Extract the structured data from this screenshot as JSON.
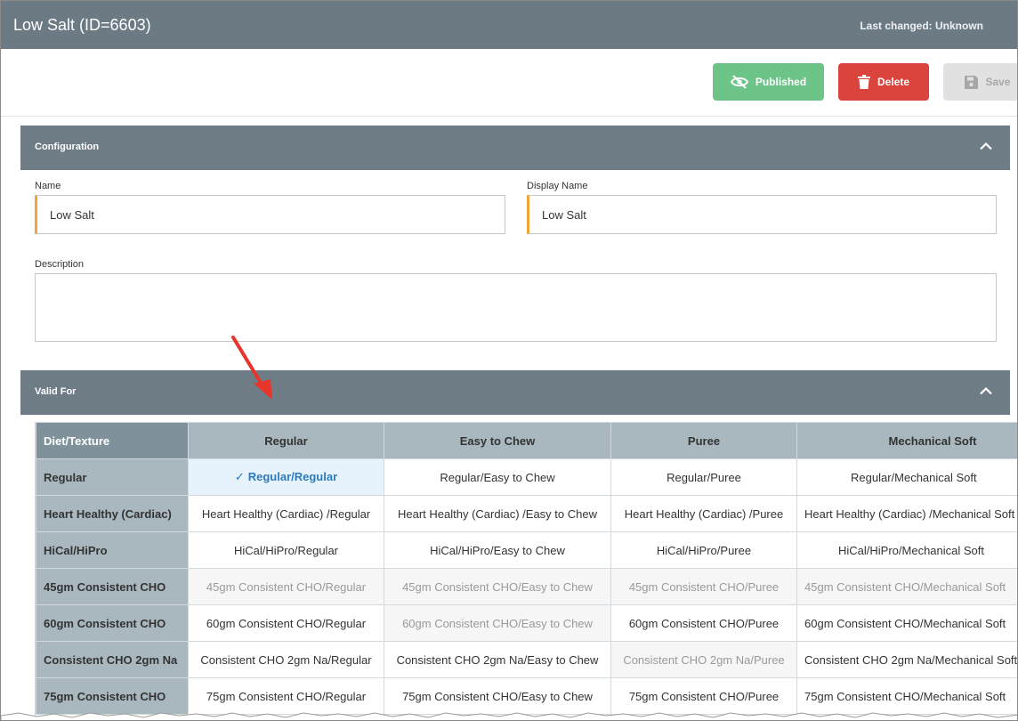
{
  "header": {
    "title": "Low Salt (ID=6603)",
    "last_changed": "Last changed: Unknown"
  },
  "toolbar": {
    "published_label": "Published",
    "delete_label": "Delete",
    "save_label": "Save"
  },
  "configuration": {
    "title": "Configuration",
    "name_label": "Name",
    "name_value": "Low Salt",
    "display_name_label": "Display Name",
    "display_name_value": "Low Salt",
    "description_label": "Description",
    "description_value": ""
  },
  "valid_for": {
    "title": "Valid For",
    "corner_label": "Diet/Texture",
    "columns": [
      "Regular",
      "Easy to Chew",
      "Puree",
      "Mechanical Soft"
    ],
    "rows": [
      {
        "label": "Regular",
        "cells": [
          "Regular/Regular",
          "Regular/Easy to Chew",
          "Regular/Puree",
          "Regular/Mechanical Soft"
        ]
      },
      {
        "label": "Heart Healthy (Cardiac)",
        "cells": [
          "Heart Healthy (Cardiac) /Regular",
          "Heart Healthy (Cardiac) /Easy to Chew",
          "Heart Healthy (Cardiac) /Puree",
          "Heart Healthy (Cardiac) /Mechanical Soft"
        ]
      },
      {
        "label": "HiCal/HiPro",
        "cells": [
          "HiCal/HiPro/Regular",
          "HiCal/HiPro/Easy to Chew",
          "HiCal/HiPro/Puree",
          "HiCal/HiPro/Mechanical Soft"
        ]
      },
      {
        "label": "45gm Consistent CHO",
        "cells": [
          "45gm Consistent CHO/Regular",
          "45gm Consistent CHO/Easy to Chew",
          "45gm Consistent CHO/Puree",
          "45gm Consistent CHO/Mechanical Soft"
        ]
      },
      {
        "label": "60gm Consistent CHO",
        "cells": [
          "60gm Consistent CHO/Regular",
          "60gm Consistent CHO/Easy to Chew",
          "60gm Consistent CHO/Puree",
          "60gm Consistent CHO/Mechanical Soft"
        ]
      },
      {
        "label": "Consistent CHO 2gm Na",
        "cells": [
          "Consistent CHO 2gm Na/Regular",
          "Consistent CHO 2gm Na/Easy to Chew",
          "Consistent CHO 2gm Na/Puree",
          "Consistent CHO 2gm Na/Mechanical Soft"
        ]
      },
      {
        "label": "75gm Consistent CHO",
        "cells": [
          "75gm Consistent CHO/Regular",
          "75gm Consistent CHO/Easy to Chew",
          "75gm Consistent CHO/Puree",
          "75gm Consistent CHO/Mechanical Soft"
        ]
      }
    ]
  },
  "colors": {
    "header": "#6c7a84",
    "published": "#6cc489",
    "delete": "#d9443d",
    "save_disabled": "#e1e1e1",
    "section_header": "#6e7c86",
    "field_accent": "#f0a43a",
    "selected_cell": "#e7f3fc",
    "selected_text": "#2c7bc0",
    "annotation_arrow": "#e8352b"
  },
  "icons": {
    "published": "eye-slash-icon",
    "delete": "trash-icon",
    "save": "floppy-disk-icon",
    "collapse": "chevron-up-icon",
    "selected": "check-icon",
    "annotation": "red-arrow-icon"
  }
}
